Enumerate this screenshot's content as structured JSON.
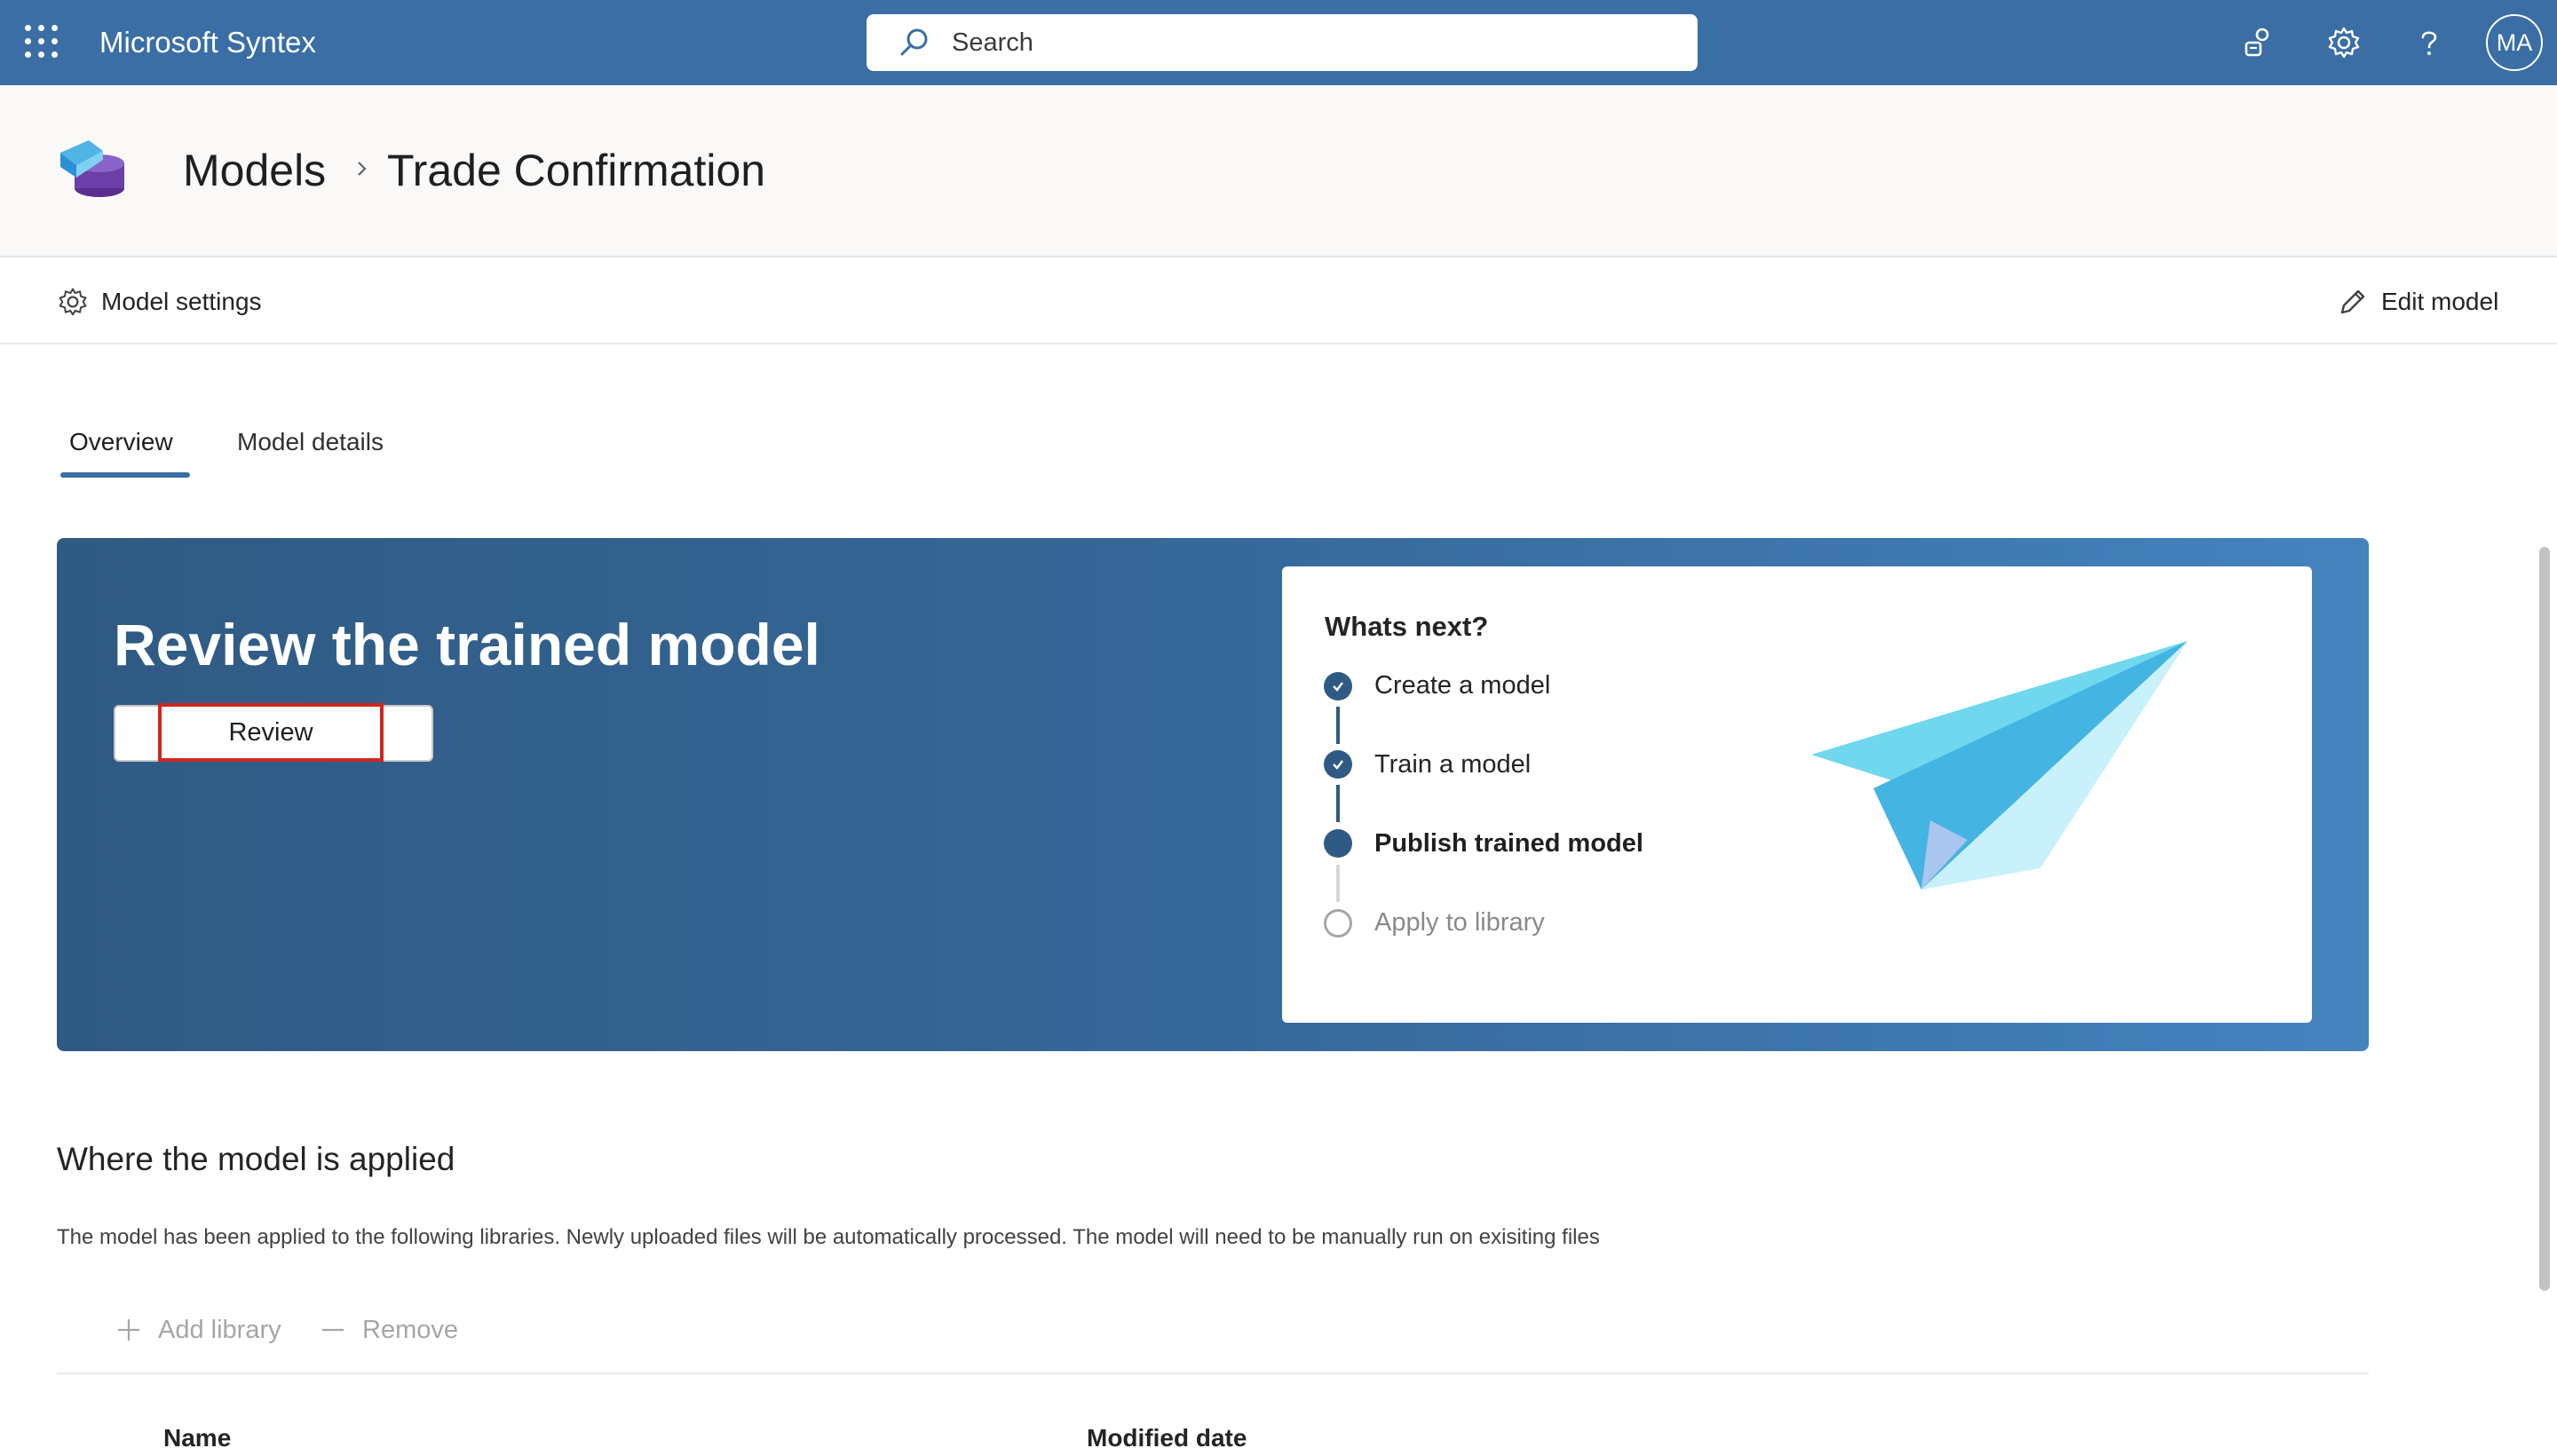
{
  "suite_bar": {
    "app_name": "Microsoft Syntex",
    "search_placeholder": "Search",
    "avatar_initials": "MA",
    "icons": [
      "waffle-icon",
      "search-icon",
      "feedback-icon",
      "settings-gear-icon",
      "help-icon"
    ]
  },
  "breadcrumb": {
    "root": "Models",
    "current": "Trade Confirmation"
  },
  "command_bar": {
    "model_settings": "Model settings",
    "edit_model": "Edit model"
  },
  "tabs": [
    {
      "label": "Overview",
      "active": true
    },
    {
      "label": "Model details",
      "active": false
    }
  ],
  "hero": {
    "title": "Review the trained model",
    "review_button": "Review",
    "whats_next": {
      "title": "Whats next?",
      "steps": [
        {
          "label": "Create a model",
          "state": "done"
        },
        {
          "label": "Train a model",
          "state": "done"
        },
        {
          "label": "Publish trained model",
          "state": "current"
        },
        {
          "label": "Apply to library",
          "state": "pending"
        }
      ]
    }
  },
  "applied_section": {
    "title": "Where the model is applied",
    "description": "The model has been applied to the following libraries. Newly uploaded files will be automatically processed. The model will need to be manually run on exisiting files",
    "add_library": "Add library",
    "remove": "Remove",
    "columns": [
      "Name",
      "Modified date"
    ]
  },
  "colors": {
    "suite_bar": "#3a6ea5",
    "hero_start": "#2f5a83",
    "hero_end": "#4483be",
    "highlight": "#d0271d",
    "step_done": "#2f5a83",
    "step_pending": "#a6a6a6"
  }
}
